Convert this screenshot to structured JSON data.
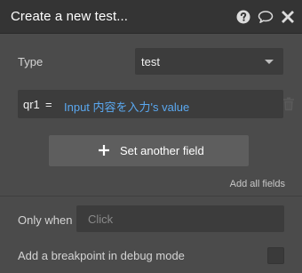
{
  "window": {
    "title": "Create a new test...",
    "icons": [
      "help-icon",
      "comment-icon",
      "close-icon"
    ]
  },
  "type_row": {
    "label": "Type",
    "value": "test"
  },
  "fields": [
    {
      "key": "qr1",
      "operator": "=",
      "value": "Input 内容を入力's value"
    }
  ],
  "actions": {
    "set_another_field": "Set another field",
    "add_all_fields": "Add all fields"
  },
  "only_when": {
    "label": "Only when",
    "placeholder": "Click"
  },
  "breakpoint": {
    "label": "Add a breakpoint in debug mode",
    "checked": false
  },
  "colors": {
    "title_bar": "#343434",
    "panel": "#4b4b4b",
    "input_bg": "#3c3c3c",
    "button_bg": "#5e5e5e",
    "dynamic_value": "#5aa8f0"
  }
}
